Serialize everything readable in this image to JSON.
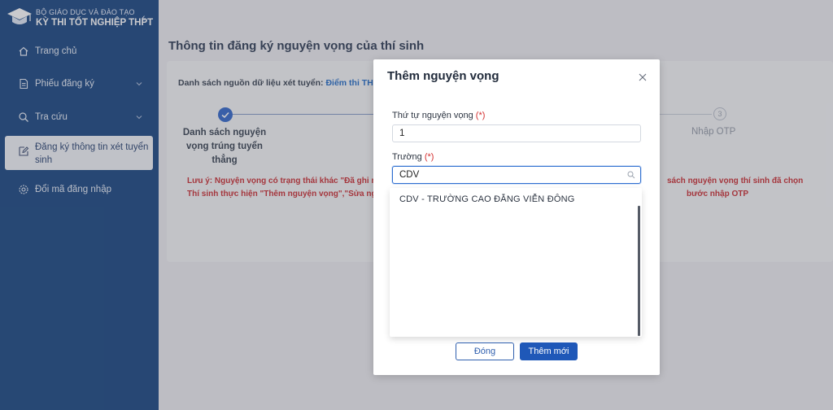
{
  "brand": {
    "ministry": "BỘ GIÁO DỤC VÀ ĐÀO TẠO",
    "exam": "KỲ THI TỐT NGHIỆP THPT",
    "logo_icon": "graduation-cap-icon",
    "collapse_glyph": "‹"
  },
  "sidebar": {
    "items": [
      {
        "label": "Trang chủ",
        "icon": "home-icon"
      },
      {
        "label": "Phiếu đăng ký",
        "icon": "document-icon"
      },
      {
        "label": "Tra cứu",
        "icon": "search-icon"
      },
      {
        "label": "Đăng ký thông tin xét tuyển sinh",
        "icon": "edit-icon",
        "active": true
      },
      {
        "label": "Đổi mã đăng nhập",
        "icon": "gear-icon"
      }
    ]
  },
  "main": {
    "title": "Thông tin đăng ký nguyện vọng của thí sinh",
    "source_label": "Danh sách nguồn dữ liệu xét tuyển:",
    "source_value": "Điểm thi THPT",
    "steps": [
      {
        "label": "Danh sách nguyện vọng trúng tuyển thẳng",
        "state": "done"
      },
      {
        "label": "Nhập OTP",
        "number": "3",
        "state": "pending"
      }
    ],
    "warning_line1": "Lưu ý: Nguyện vọng có trạng thái khác \"Đã ghi nhận\"",
    "warning_line2": "Thí sinh thực hiện \"Thêm nguyện vọng\",\"Sửa nguyện vọng\"",
    "warning_right1": "sách nguyện vọng thí sinh đã chọn",
    "warning_right2": "bước nhập OTP"
  },
  "modal": {
    "title": "Thêm nguyện vọng",
    "order_label": "Thứ tự nguyện vọng",
    "required_mark": "(*)",
    "order_value": "1",
    "school_label": "Trường",
    "school_value": "CDV",
    "options": [
      "CDV - TRƯỜNG CAO ĐẲNG VIỄN ĐÔNG"
    ],
    "close_button": "Đóng",
    "add_button": "Thêm mới"
  },
  "colors": {
    "sidebar": "#0f3f7c",
    "primary": "#1f58b8",
    "warning": "#c8262b"
  }
}
